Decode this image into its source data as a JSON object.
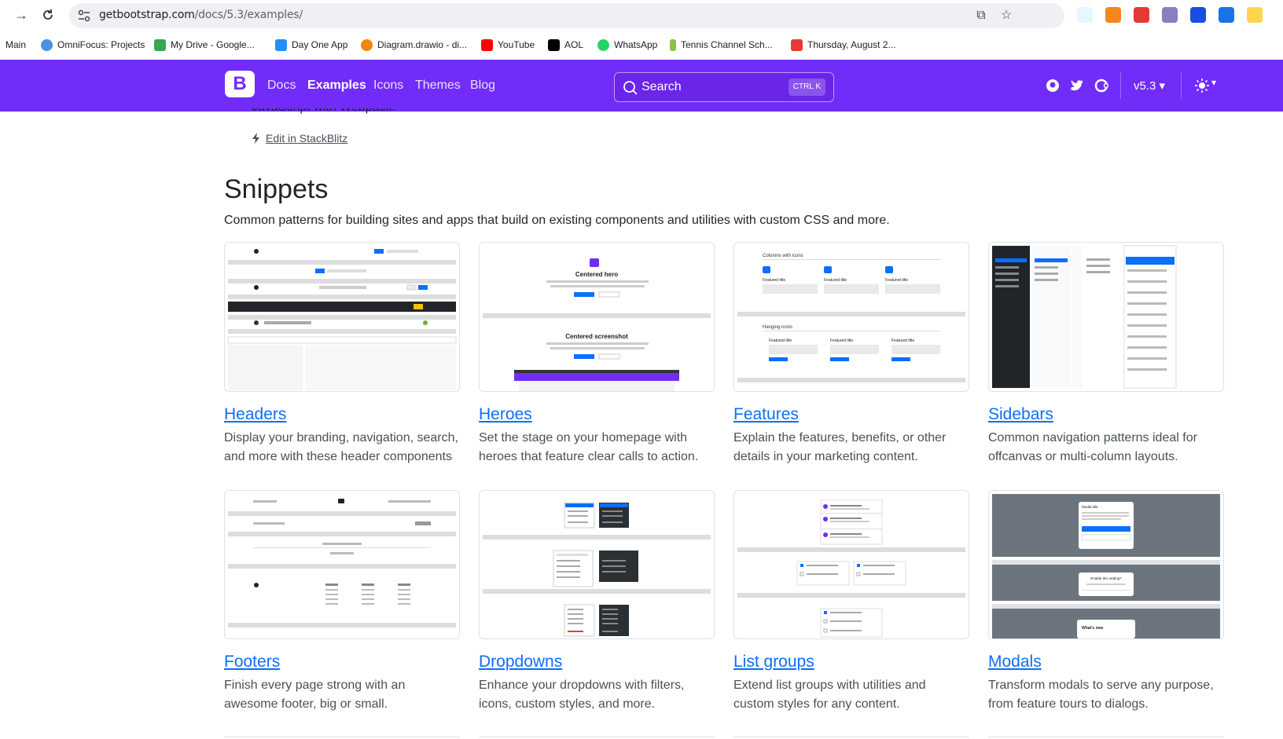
{
  "browser": {
    "url_domain": "getbootstrap.com",
    "url_path": "/docs/5.3/examples/"
  },
  "bookmarks": [
    {
      "label": "Main",
      "color": ""
    },
    {
      "label": "OmniFocus: Projects",
      "color": "#4a90e2"
    },
    {
      "label": "My Drive - Google...",
      "color": "#34a853"
    },
    {
      "label": "Day One App",
      "color": "#1e90ff"
    },
    {
      "label": "Diagram.drawio - di...",
      "color": "#f08705"
    },
    {
      "label": "YouTube",
      "color": "#ff0000"
    },
    {
      "label": "AOL",
      "color": "#000000"
    },
    {
      "label": "WhatsApp",
      "color": "#25d366"
    },
    {
      "label": "Tennis Channel Sch...",
      "color": "#8bc34a"
    },
    {
      "label": "Thursday, August 2...",
      "color": "#e53935"
    }
  ],
  "navbar": {
    "brand": "B",
    "links": [
      {
        "label": "Docs",
        "active": false
      },
      {
        "label": "Examples",
        "active": true
      },
      {
        "label": "Icons",
        "active": false
      },
      {
        "label": "Themes",
        "active": false
      },
      {
        "label": "Blog",
        "active": false
      }
    ],
    "search_placeholder": "Search",
    "search_kbd": "CTRL K",
    "version": "v5.3"
  },
  "page": {
    "partial_text": "JavaScript with Webpack.",
    "edit_link": "Edit in StackBlitz",
    "section_title": "Snippets",
    "section_lead": "Common patterns for building sites and apps that build on existing components and utilities with custom CSS and more."
  },
  "cards": [
    {
      "title": "Headers",
      "desc": "Display your branding, navigation, search, and more with these header components"
    },
    {
      "title": "Heroes",
      "desc": "Set the stage on your homepage with heroes that feature clear calls to action."
    },
    {
      "title": "Features",
      "desc": "Explain the features, benefits, or other details in your marketing content."
    },
    {
      "title": "Sidebars",
      "desc": "Common navigation patterns ideal for offcanvas or multi-column layouts."
    },
    {
      "title": "Footers",
      "desc": "Finish every page strong with an awesome footer, big or small."
    },
    {
      "title": "Dropdowns",
      "desc": "Enhance your dropdowns with filters, icons, custom styles, and more."
    },
    {
      "title": "List groups",
      "desc": "Extend list groups with utilities and custom styles for any content."
    },
    {
      "title": "Modals",
      "desc": "Transform modals to serve any purpose, from feature tours to dialogs."
    }
  ],
  "thumb_text": {
    "hero1": "Centered hero",
    "hero2": "Centered screenshot",
    "features1": "Columns with icons",
    "features2": "Hanging icons",
    "feature_item": "Featured title",
    "modal_top": "Modal title",
    "modal_mid": "Enable this setting?",
    "modal_bottom": "What's new"
  },
  "colors": {
    "brand": "#712cf9",
    "link": "#0d6efd"
  }
}
